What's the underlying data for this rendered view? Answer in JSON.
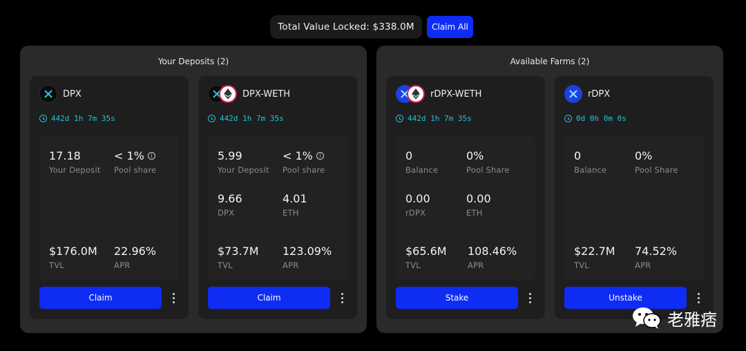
{
  "header": {
    "tvl_text": "Total Value Locked: $338.0M",
    "claim_all_label": "Claim All"
  },
  "deposits_panel": {
    "title": "Your Deposits (2)",
    "cards": [
      {
        "token": "DPX",
        "icons": [
          "dpx-icon"
        ],
        "timer": "442d 1h 7m 35s",
        "stat1_value": "17.18",
        "stat1_label": "Your Deposit",
        "stat2_value": "< 1%",
        "stat2_label": "Pool share",
        "tvl_value": "$176.0M",
        "tvl_label": "TVL",
        "apr_value": "22.96%",
        "apr_label": "APR",
        "button_label": "Claim"
      },
      {
        "token": "DPX-WETH",
        "icons": [
          "dpx-icon",
          "eth-icon"
        ],
        "timer": "442d 1h 7m 35s",
        "stat1_value": "5.99",
        "stat1_label": "Your Deposit",
        "stat2_value": "< 1%",
        "stat2_label": "Pool share",
        "stat3_value": "9.66",
        "stat3_label": "DPX",
        "stat4_value": "4.01",
        "stat4_label": "ETH",
        "tvl_value": "$73.7M",
        "tvl_label": "TVL",
        "apr_value": "123.09%",
        "apr_label": "APR",
        "button_label": "Claim"
      }
    ]
  },
  "farms_panel": {
    "title": "Available Farms (2)",
    "cards": [
      {
        "token": "rDPX-WETH",
        "icons": [
          "rdpx-icon",
          "eth-icon"
        ],
        "timer": "442d 1h 7m 35s",
        "stat1_value": "0",
        "stat1_label": "Balance",
        "stat2_value": "0%",
        "stat2_label": "Pool Share",
        "stat3_value": "0.00",
        "stat3_label": "rDPX",
        "stat4_value": "0.00",
        "stat4_label": "ETH",
        "tvl_value": "$65.6M",
        "tvl_label": "TVL",
        "apr_value": "108.46%",
        "apr_label": "APR",
        "button_label": "Stake"
      },
      {
        "token": "rDPX",
        "icons": [
          "rdpx-icon"
        ],
        "timer": "0d 0h 0m 0s",
        "stat1_value": "0",
        "stat1_label": "Balance",
        "stat2_value": "0%",
        "stat2_label": "Pool Share",
        "tvl_value": "$22.7M",
        "tvl_label": "TVL",
        "apr_value": "74.52%",
        "apr_label": "APR",
        "button_label": "Unstake"
      }
    ]
  },
  "watermark": {
    "text": "老雅痞",
    "icon": "wechat-icon"
  },
  "colors": {
    "accent_button": "#0f2cf5",
    "timer_cyan": "#22c3d6",
    "panel_bg": "#2a2a2b",
    "card_bg": "#1e1e1f",
    "label_gray": "#8b8b8e"
  }
}
